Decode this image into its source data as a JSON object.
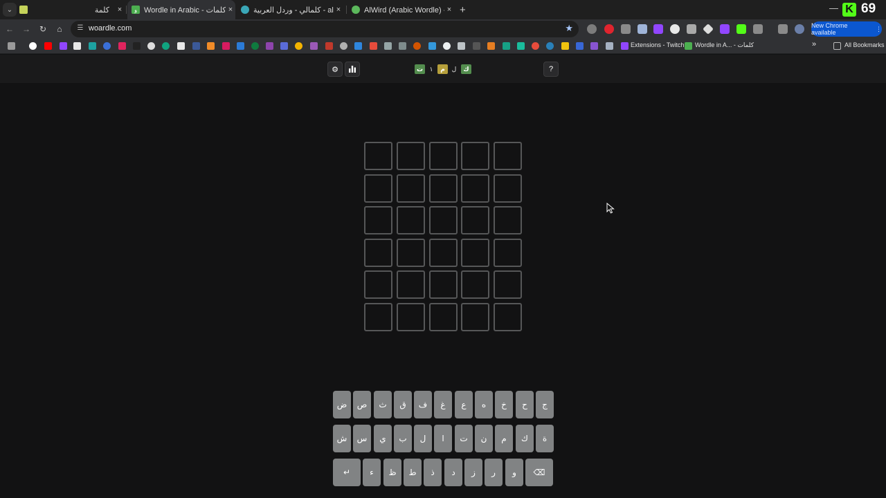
{
  "browser": {
    "tabs": [
      {
        "title": "كلمة",
        "favicon_color": "#c5d35a",
        "active": false
      },
      {
        "title": "Wordle in Arabic - كلمات",
        "favicon_color": "#4caf50",
        "active": true
      },
      {
        "title": "كلمالي - وردل العربية - aly.com",
        "favicon_color": "#3aa7b7",
        "active": false
      },
      {
        "title": "AlWird (Arabic Wordle) - الورد",
        "favicon_color": "#5cb85c",
        "active": false
      }
    ],
    "close_glyph": "×",
    "new_tab_glyph": "+",
    "minimize_glyph": "—",
    "badge_letter": "K",
    "badge_count": "69",
    "url": "woardle.com",
    "update_button": "New Chrome available",
    "bookmarks": {
      "extensions_label": "Extensions - Twitch",
      "wordle_label": "Wordle in A... - كلمات",
      "all_label": "All Bookmarks",
      "overflow_glyph": "»"
    }
  },
  "app": {
    "header": {
      "settings_icon": "⚙",
      "stats_icon": "▮",
      "help_label": "?",
      "logo": [
        {
          "ch": "ت",
          "state": "correct"
        },
        {
          "ch": "١",
          "state": "plain"
        },
        {
          "ch": "م",
          "state": "present"
        },
        {
          "ch": "ل",
          "state": "plain"
        },
        {
          "ch": "ك",
          "state": "correct"
        }
      ]
    },
    "colors": {
      "correct": "#538d4e",
      "present": "#b59f3b",
      "empty_border": "#565758",
      "key_bg": "#818384"
    },
    "board": {
      "rows": [
        [
          "",
          "",
          "",
          "",
          ""
        ],
        [
          "",
          "",
          "",
          "",
          ""
        ],
        [
          "",
          "",
          "",
          "",
          ""
        ],
        [
          "",
          "",
          "",
          "",
          ""
        ],
        [
          "",
          "",
          "",
          "",
          ""
        ],
        [
          "",
          "",
          "",
          "",
          ""
        ]
      ]
    },
    "keyboard": {
      "row1": [
        "ض",
        "ص",
        "ث",
        "ق",
        "ف",
        "غ",
        "ع",
        "ه",
        "خ",
        "ح",
        "ج"
      ],
      "row2": [
        "ش",
        "س",
        "ي",
        "ب",
        "ل",
        "ا",
        "ت",
        "ن",
        "م",
        "ك",
        "ة"
      ],
      "row3": [
        "↵",
        "ء",
        "ظ",
        "ط",
        "ذ",
        "د",
        "ز",
        "ر",
        "و",
        "⌫"
      ]
    }
  }
}
